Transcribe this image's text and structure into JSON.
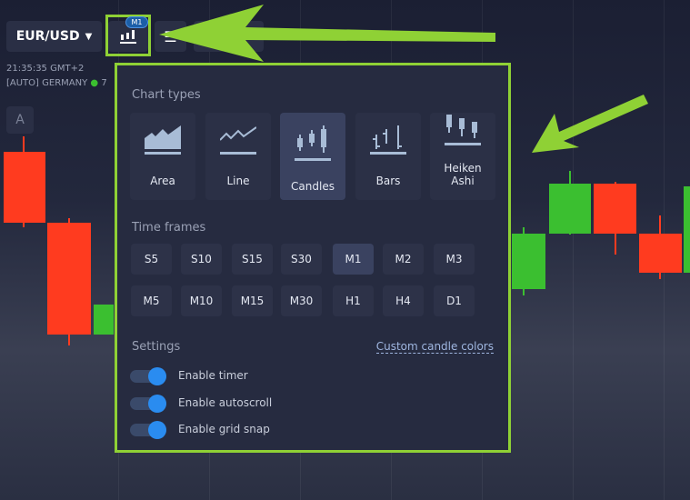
{
  "toolbar": {
    "pair": "EUR/USD",
    "timeframe_badge": "M1"
  },
  "info": {
    "time": "21:35:35 GMT+2",
    "region": "[AUTO] GERMANY",
    "region_suffix": "7"
  },
  "side_button": "A",
  "popup": {
    "chart_types_title": "Chart types",
    "chart_types": [
      {
        "label": "Area",
        "icon": "area-chart-icon"
      },
      {
        "label": "Line",
        "icon": "line-chart-icon"
      },
      {
        "label": "Candles",
        "icon": "candles-icon",
        "selected": true
      },
      {
        "label": "Bars",
        "icon": "bars-icon"
      },
      {
        "label": "Heiken Ashi",
        "icon": "heiken-ashi-icon"
      }
    ],
    "time_frames_title": "Time frames",
    "time_frames": [
      "S5",
      "S10",
      "S15",
      "S30",
      "M1",
      "M2",
      "M3",
      "M5",
      "M10",
      "M15",
      "M30",
      "H1",
      "H4",
      "D1"
    ],
    "selected_time_frame": "M1",
    "settings_title": "Settings",
    "custom_colors_link": "Custom candle colors",
    "settings": [
      {
        "label": "Enable timer",
        "on": true
      },
      {
        "label": "Enable autoscroll",
        "on": true
      },
      {
        "label": "Enable grid snap",
        "on": true
      }
    ]
  },
  "colors": {
    "highlight": "#8fd135",
    "bull": "#3bbf30",
    "bear": "#ff3b1f",
    "toggle": "#2a8cf0"
  }
}
